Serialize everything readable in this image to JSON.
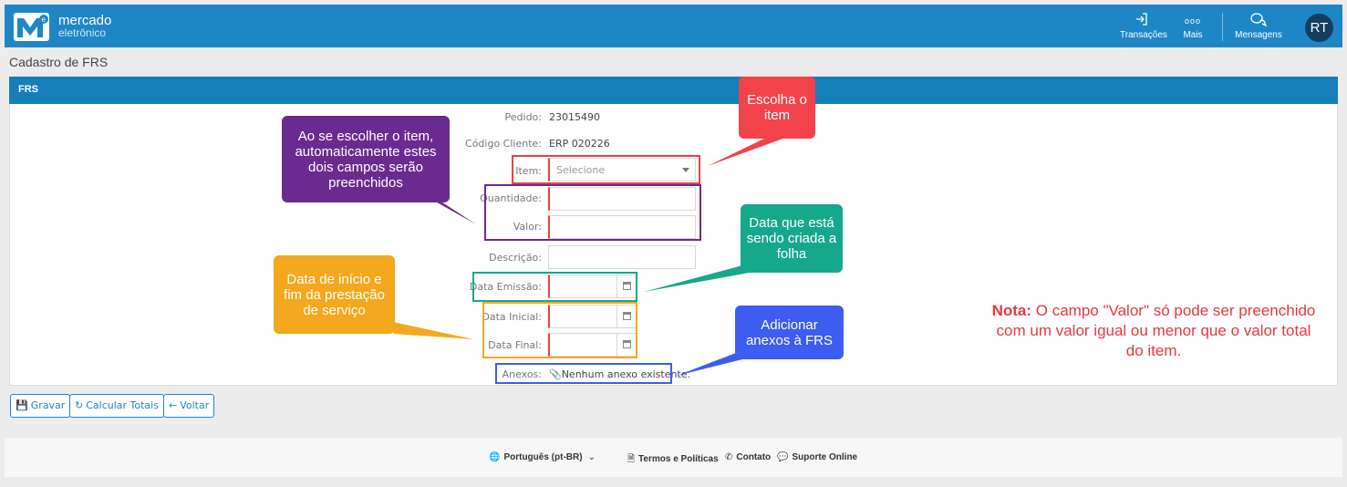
{
  "header": {
    "logo_line1": "mercado",
    "logo_line2": "eletrônico",
    "nav": [
      {
        "icon": "sign-in-icon",
        "label": "Transações"
      },
      {
        "icon": "more-icon",
        "label": "Mais"
      },
      {
        "icon": "messages-icon",
        "label": "Mensagens"
      }
    ],
    "avatar_initials": "RT"
  },
  "page_title": "Cadastro de FRS",
  "panel_title": "FRS",
  "form": {
    "pedido_label": "Pedido:",
    "pedido_value": "23015490",
    "codigo_label": "Código Cliente:",
    "codigo_value": "ERP 020226",
    "item_label": "Item:",
    "item_selected": "Selecione",
    "quantidade_label": "Quantidade:",
    "valor_label": "Valor:",
    "descricao_label": "Descrição:",
    "data_emissao_label": "Data Emissão:",
    "data_inicial_label": "Data Inicial:",
    "data_final_label": "Data Final:",
    "anexos_label": "Anexos:",
    "anexos_value": "Nenhum anexo existente."
  },
  "callouts": {
    "item": "Escolha o item",
    "auto": "Ao se escolher o item, automaticamente estes dois campos serão preenchidos",
    "emissao": "Data que está sendo criada a folha",
    "periodo": "Data de início e fim da prestação de serviço",
    "anexos": "Adicionar anexos à FRS"
  },
  "note": {
    "bold": "Nota:",
    "text": " O campo \"Valor\" só pode ser preenchido com um valor igual ou menor que o valor total do item."
  },
  "buttons": {
    "gravar": "Gravar",
    "calcular": "Calcular Totais",
    "voltar": "Voltar"
  },
  "footer": {
    "language": "Português (pt-BR)",
    "terms": "Termos e Políticas",
    "contact": "Contato",
    "support": "Suporte Online"
  },
  "colors": {
    "topbar": "#1f86c6",
    "panel_header": "#157fb9",
    "required": "#e8414a",
    "callout_red": "#f2424a",
    "callout_purple": "#6b2a8f",
    "callout_teal": "#16a88a",
    "callout_orange": "#f4a81d",
    "callout_blue": "#3d5cf0",
    "note_red": "#e8383f"
  }
}
